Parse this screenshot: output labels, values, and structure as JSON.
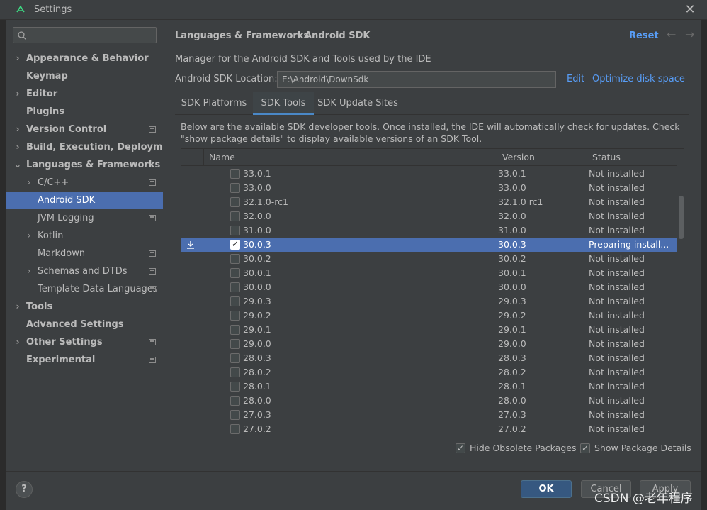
{
  "window": {
    "title": "Settings"
  },
  "sidebar": {
    "search": {
      "placeholder": ""
    },
    "items": [
      {
        "label": "Appearance & Behavior",
        "chevron": "›",
        "bold": true
      },
      {
        "label": "Keymap",
        "chevron": "",
        "bold": true
      },
      {
        "label": "Editor",
        "chevron": "›",
        "bold": true
      },
      {
        "label": "Plugins",
        "chevron": "",
        "bold": true
      },
      {
        "label": "Version Control",
        "chevron": "›",
        "bold": true
      },
      {
        "label": "Build, Execution, Deployment",
        "chevron": "›",
        "bold": true
      },
      {
        "label": "Languages & Frameworks",
        "chevron": "⌄",
        "bold": true
      },
      {
        "label": "C/C++",
        "chevron": "›",
        "bold": false
      },
      {
        "label": "Android SDK",
        "chevron": "",
        "bold": false
      },
      {
        "label": "JVM Logging",
        "chevron": "",
        "bold": false
      },
      {
        "label": "Kotlin",
        "chevron": "›",
        "bold": false
      },
      {
        "label": "Markdown",
        "chevron": "",
        "bold": false
      },
      {
        "label": "Schemas and DTDs",
        "chevron": "›",
        "bold": false
      },
      {
        "label": "Template Data Languages",
        "chevron": "",
        "bold": false
      },
      {
        "label": "Tools",
        "chevron": "›",
        "bold": true
      },
      {
        "label": "Advanced Settings",
        "chevron": "",
        "bold": true
      },
      {
        "label": "Other Settings",
        "chevron": "›",
        "bold": true
      },
      {
        "label": "Experimental",
        "chevron": "",
        "bold": true
      }
    ]
  },
  "header": {
    "breadcrumb_parent": "Languages & Frameworks",
    "breadcrumb_separator": "›",
    "breadcrumb_current": "Android SDK",
    "reset_label": "Reset",
    "back_glyph": "←",
    "forward_glyph": "→"
  },
  "main": {
    "description": "Manager for the Android SDK and Tools used by the IDE",
    "location_label": "Android SDK Location:",
    "location_value": "E:\\Android\\DownSdk",
    "edit_label": "Edit",
    "optimize_label": "Optimize disk space",
    "tabs": [
      {
        "label": "SDK Platforms"
      },
      {
        "label": "SDK Tools"
      },
      {
        "label": "SDK Update Sites"
      }
    ],
    "note": "Below are the available SDK developer tools. Once installed, the IDE will automatically check for updates. Check \"show package details\" to display available versions of an SDK Tool."
  },
  "table": {
    "columns": {
      "name": "Name",
      "version": "Version",
      "status": "Status"
    },
    "rows": [
      {
        "name": "33.0.1",
        "version": "33.0.1",
        "status": "Not installed",
        "checked": false
      },
      {
        "name": "33.0.0",
        "version": "33.0.0",
        "status": "Not installed",
        "checked": false
      },
      {
        "name": "32.1.0-rc1",
        "version": "32.1.0 rc1",
        "status": "Not installed",
        "checked": false
      },
      {
        "name": "32.0.0",
        "version": "32.0.0",
        "status": "Not installed",
        "checked": false
      },
      {
        "name": "31.0.0",
        "version": "31.0.0",
        "status": "Not installed",
        "checked": false
      },
      {
        "name": "30.0.3",
        "version": "30.0.3",
        "status": "Preparing install...",
        "checked": true
      },
      {
        "name": "30.0.2",
        "version": "30.0.2",
        "status": "Not installed",
        "checked": false
      },
      {
        "name": "30.0.1",
        "version": "30.0.1",
        "status": "Not installed",
        "checked": false
      },
      {
        "name": "30.0.0",
        "version": "30.0.0",
        "status": "Not installed",
        "checked": false
      },
      {
        "name": "29.0.3",
        "version": "29.0.3",
        "status": "Not installed",
        "checked": false
      },
      {
        "name": "29.0.2",
        "version": "29.0.2",
        "status": "Not installed",
        "checked": false
      },
      {
        "name": "29.0.1",
        "version": "29.0.1",
        "status": "Not installed",
        "checked": false
      },
      {
        "name": "29.0.0",
        "version": "29.0.0",
        "status": "Not installed",
        "checked": false
      },
      {
        "name": "28.0.3",
        "version": "28.0.3",
        "status": "Not installed",
        "checked": false
      },
      {
        "name": "28.0.2",
        "version": "28.0.2",
        "status": "Not installed",
        "checked": false
      },
      {
        "name": "28.0.1",
        "version": "28.0.1",
        "status": "Not installed",
        "checked": false
      },
      {
        "name": "28.0.0",
        "version": "28.0.0",
        "status": "Not installed",
        "checked": false
      },
      {
        "name": "27.0.3",
        "version": "27.0.3",
        "status": "Not installed",
        "checked": false
      },
      {
        "name": "27.0.2",
        "version": "27.0.2",
        "status": "Not installed",
        "checked": false
      }
    ]
  },
  "options": {
    "hide_obsolete_label": "Hide Obsolete Packages",
    "hide_obsolete_checked": true,
    "show_details_label": "Show Package Details",
    "show_details_checked": true
  },
  "footer": {
    "help_label": "?",
    "ok_label": "OK",
    "cancel_label": "Cancel",
    "apply_label": "Apply"
  },
  "watermark": "CSDN @老年程序",
  "colors": {
    "accent_link": "#589df6",
    "selection": "#4b6eaf",
    "ok_button": "#365880"
  }
}
